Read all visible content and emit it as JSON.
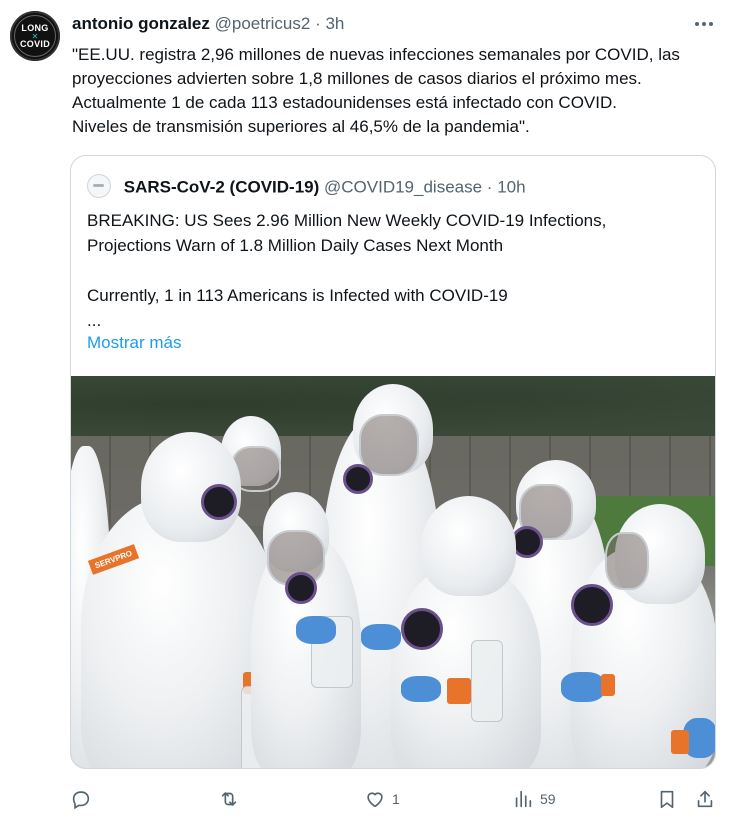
{
  "tweet": {
    "avatar_lines": [
      "LONG",
      "COVID"
    ],
    "author_name": "antonio gonzalez",
    "author_handle": "@poetricus2",
    "separator": "·",
    "time": "3h",
    "more_icon": "more-dots-icon",
    "text_lines": [
      "\"EE.UU. registra 2,96 millones de nuevas infecciones semanales por COVID, las",
      "proyecciones advierten sobre 1,8 millones de casos diarios el próximo mes.",
      "Actualmente 1 de cada 113 estadounidenses está infectado con COVID.",
      "Niveles de transmisión superiores al 46,5% de la pandemia\"."
    ]
  },
  "quote": {
    "name": "SARS-CoV-2 (COVID-19)",
    "handle": "@COVID19_disease",
    "separator": "·",
    "time": "10h",
    "text_lines": [
      "BREAKING: US Sees 2.96 Million New Weekly COVID-19 Infections,",
      "Projections Warn of 1.8 Million Daily Cases Next Month",
      "",
      "Currently, 1 in 113 Americans is Infected with COVID-19",
      "..."
    ],
    "show_more": "Mostrar más",
    "image_label": "SERVPRO"
  },
  "actions": {
    "reply": {
      "icon": "reply-icon",
      "count": ""
    },
    "retweet": {
      "icon": "retweet-icon",
      "count": ""
    },
    "like": {
      "icon": "heart-icon",
      "count": "1"
    },
    "views": {
      "icon": "views-chart-icon",
      "count": "59"
    },
    "bookmark": {
      "icon": "bookmark-icon"
    },
    "share": {
      "icon": "share-icon"
    }
  },
  "colors": {
    "text": "#0f1419",
    "secondary": "#536471",
    "link": "#1d9bf0",
    "border": "#cfd9de"
  }
}
